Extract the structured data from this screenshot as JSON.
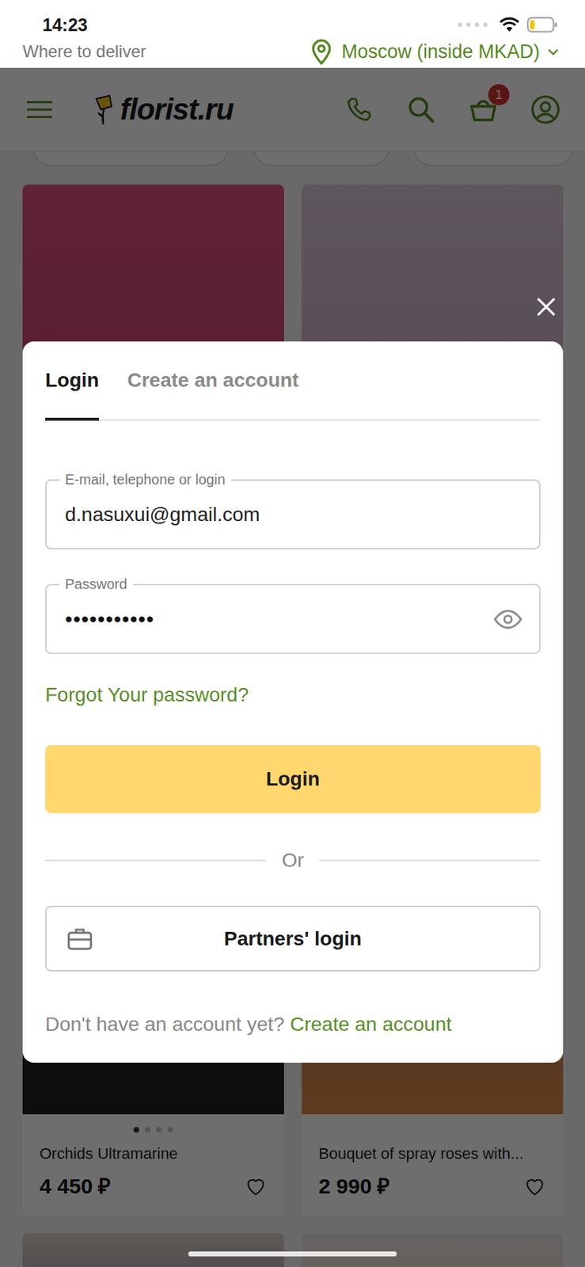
{
  "status_bar": {
    "time": "14:23",
    "battery": {
      "level": 0.2
    }
  },
  "delivery_bar": {
    "label": "Where to deliver",
    "location": "Moscow (inside MKAD)"
  },
  "header": {
    "logo": "florist.ru",
    "cart_badge": "1"
  },
  "products": [
    {
      "name": "Orchids Ultramarine",
      "price": "4 450 ₽",
      "favorite": false,
      "carousel": [
        {
          "selected": true
        },
        {
          "selected": false
        },
        {
          "selected": false
        },
        {
          "selected": false
        }
      ]
    },
    {
      "name": "Bouquet of spray roses with...",
      "price": "2 990 ₽",
      "favorite": false,
      "carousel": []
    }
  ],
  "dialog": {
    "tabs": [
      {
        "label": "Login",
        "selected": true
      },
      {
        "label": "Create an account",
        "selected": false
      }
    ],
    "fields": [
      {
        "label": "E-mail, telephone or login",
        "value": "d.nasuxui@gmail.com",
        "kind": "text"
      },
      {
        "label": "Password",
        "value": "•••••••••••",
        "kind": "password"
      }
    ],
    "password_revealed": false,
    "forgot_link": "Forgot Your password?",
    "submit": "Login",
    "divider": "Or",
    "partners_button": "Partners' login",
    "signup_prompt": "Don't have an account yet?",
    "signup_link": "Create an account"
  }
}
